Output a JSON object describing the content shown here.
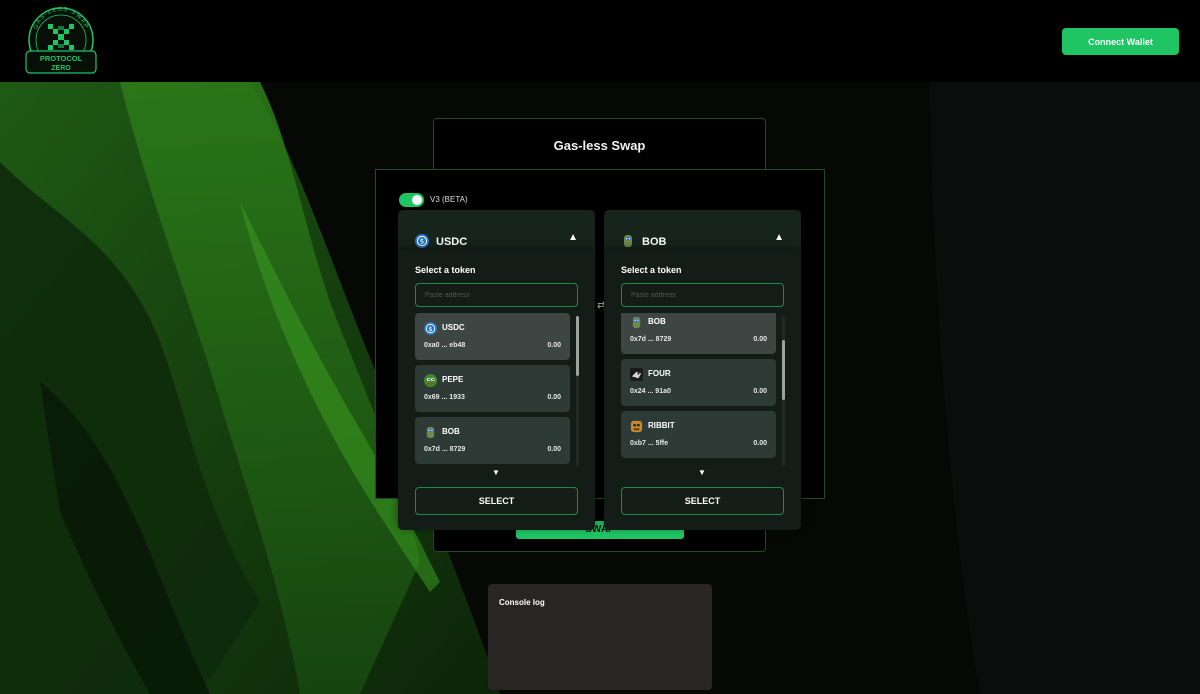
{
  "header": {
    "logo": {
      "ring_text": "GAS-LESS SWAP",
      "name_line1": "PROTOCOL",
      "name_line2": "ZERO"
    },
    "connect_wallet_label": "Connect Wallet"
  },
  "main": {
    "title": "Gas-less Swap",
    "version_toggle": {
      "label": "V3 (BETA)",
      "enabled": true
    },
    "swap_button_label": "SWAP",
    "from_token": {
      "selected": {
        "symbol": "USDC",
        "icon": "usdc-icon"
      },
      "caret_icon": "triangle-up-icon",
      "dropdown": {
        "title": "Select a token",
        "search_placeholder": "Paste address",
        "tokens": [
          {
            "symbol": "USDC",
            "address": "0xa0 ... eb48",
            "balance": "0.00",
            "icon": "usdc-icon",
            "selected": true
          },
          {
            "symbol": "PEPE",
            "address": "0x69 ... 1933",
            "balance": "0.00",
            "icon": "pepe-icon"
          },
          {
            "symbol": "BOB",
            "address": "0x7d ... 8729",
            "balance": "0.00",
            "icon": "bob-icon"
          }
        ],
        "more_icon": "triangle-down-icon",
        "select_label": "SELECT"
      }
    },
    "to_token": {
      "selected": {
        "symbol": "BOB",
        "icon": "bob-icon"
      },
      "caret_icon": "triangle-up-icon",
      "dropdown": {
        "title": "Select a token",
        "search_placeholder": "Paste address",
        "tokens": [
          {
            "symbol": "BOB",
            "address": "0x7d ... 8729",
            "balance": "0.00",
            "icon": "bob-icon",
            "selected": true
          },
          {
            "symbol": "FOUR",
            "address": "0x24 ... 91a0",
            "balance": "0.00",
            "icon": "four-icon"
          },
          {
            "symbol": "RIBBIT",
            "address": "0xb7 ... 5ffe",
            "balance": "0.00",
            "icon": "ribbit-icon"
          }
        ],
        "more_icon": "triangle-down-icon",
        "select_label": "SELECT"
      }
    }
  },
  "console": {
    "title": "Console log"
  },
  "colors": {
    "accent": "#1fc463",
    "panel_border": "#1c4d28",
    "card_bg": "#141c18",
    "row_bg": "#2e3a35",
    "console_bg": "#292525"
  }
}
